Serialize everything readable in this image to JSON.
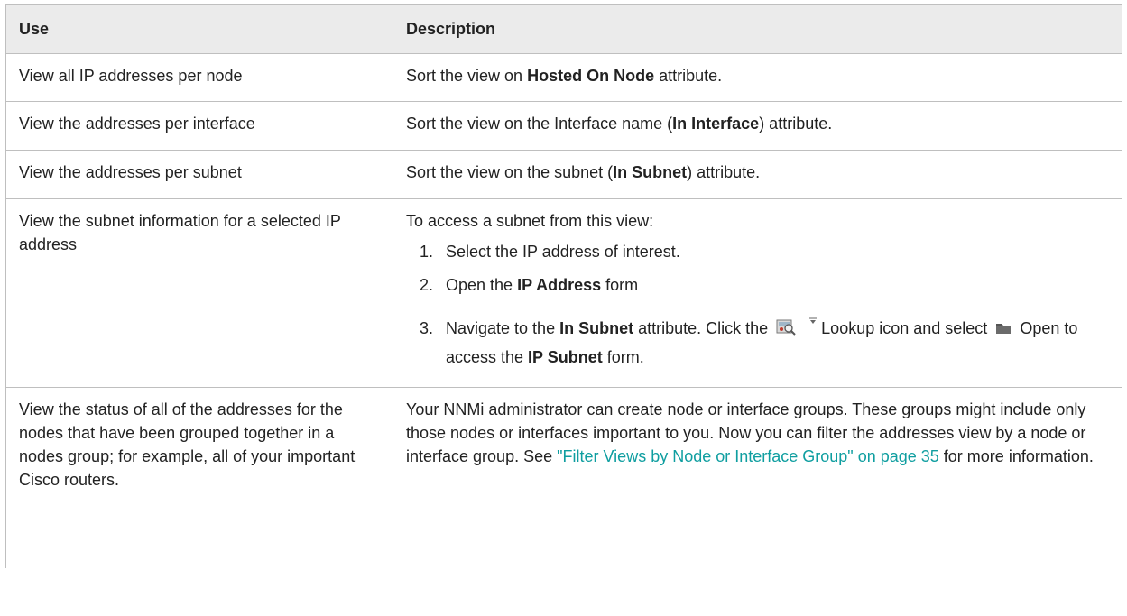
{
  "table": {
    "headers": [
      "Use",
      "Description"
    ],
    "rows": [
      {
        "use": "View all IP addresses per node",
        "desc_pre": "Sort the view on ",
        "desc_bold": "Hosted On Node",
        "desc_post": " attribute."
      },
      {
        "use": "View the addresses per interface",
        "desc_pre": "Sort the view on the Interface name (",
        "desc_bold": "In Interface",
        "desc_post": ") attribute."
      },
      {
        "use": "View the addresses per subnet",
        "desc_pre": "Sort the view on the subnet (",
        "desc_bold": "In Subnet",
        "desc_post": ") attribute."
      },
      {
        "use": "View the subnet information for a selected IP address",
        "intro": "To access a subnet from this view:",
        "step1": "Select the IP address of interest.",
        "step2_pre": "Open the ",
        "step2_bold": "IP Address",
        "step2_post": " form",
        "step3_pre": "Navigate to the ",
        "step3_bold1": "In Subnet",
        "step3_mid1": " attribute. Click the ",
        "step3_mid2": "Lookup icon and select ",
        "step3_mid3": " Open to access the ",
        "step3_bold2": "IP Subnet",
        "step3_post": " form."
      },
      {
        "use": "View the status of all of the addresses for the nodes that have been grouped together in a nodes group; for example, all of your important Cisco routers.",
        "desc_text": "Your NNMi administrator can create node or interface groups. These groups might include only those nodes or interfaces important to you. Now you can filter the addresses view by a node or interface group. See ",
        "link": "\"Filter Views by Node or Interface Group\" on page 35",
        "desc_post": " for more information."
      }
    ]
  },
  "icons": {
    "lookup": "lookup-icon",
    "dropdown": "dropdown-arrow-icon",
    "open": "folder-open-icon"
  },
  "colors": {
    "header_bg": "#ebebeb",
    "border": "#bfbfbf",
    "link": "#0f9ea0"
  }
}
